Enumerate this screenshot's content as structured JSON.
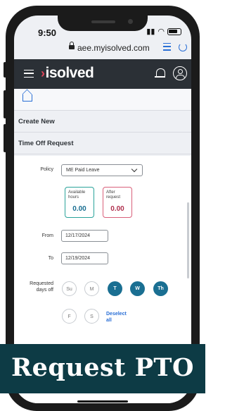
{
  "status_bar": {
    "time": "9:50"
  },
  "browser": {
    "url": "aee.myisolved.com"
  },
  "app": {
    "brand": "isolved",
    "brand_mark": "›"
  },
  "sections": {
    "create_new": "Create New",
    "time_off_request": "Time Off Request"
  },
  "form": {
    "policy_label": "Policy",
    "policy_value": "ME Paid Leave",
    "available_label_1": "Available",
    "available_label_2": "hours",
    "available_value": "0.00",
    "after_label_1": "After",
    "after_label_2": "request",
    "after_value": "0.00",
    "from_label": "From",
    "from_value": "12/17/2024",
    "to_label": "To",
    "to_value": "12/19/2024",
    "days_label_1": "Requested",
    "days_label_2": "days off",
    "days": [
      {
        "label": "Su",
        "selected": false
      },
      {
        "label": "M",
        "selected": false
      },
      {
        "label": "T",
        "selected": true
      },
      {
        "label": "W",
        "selected": true
      },
      {
        "label": "Th",
        "selected": true
      },
      {
        "label": "F",
        "selected": false
      },
      {
        "label": "S",
        "selected": false
      }
    ],
    "deselect_1": "Deselect",
    "deselect_2": "all"
  },
  "banner": {
    "text": "Request PTO"
  },
  "colors": {
    "accent_teal": "#1a6f92",
    "available_border": "#2aa39a",
    "after_border": "#d9607a",
    "banner_bg": "#0d3b45",
    "appbar_bg": "#2b3036"
  }
}
